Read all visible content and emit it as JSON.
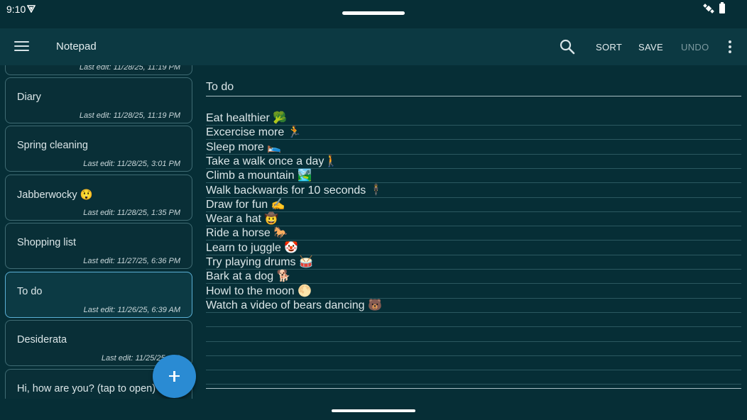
{
  "status": {
    "time": "9:10"
  },
  "appbar": {
    "title": "Notepad",
    "sort_label": "SORT",
    "save_label": "SAVE",
    "undo_label": "UNDO"
  },
  "notes": [
    {
      "title": "",
      "date": "Last edit: 11/28/25, 11:19 PM"
    },
    {
      "title": "Diary",
      "date": "Last edit: 11/28/25, 11:19 PM"
    },
    {
      "title": "Spring cleaning",
      "date": "Last edit: 11/28/25, 3:01 PM"
    },
    {
      "title": "Jabberwocky 😲",
      "date": "Last edit: 11/28/25, 1:35 PM"
    },
    {
      "title": "Shopping list",
      "date": "Last edit: 11/27/25, 6:36 PM"
    },
    {
      "title": "To do",
      "date": "Last edit: 11/26/25, 6:39 AM"
    },
    {
      "title": "Desiderata",
      "date": "Last edit: 11/25/25, 8:2"
    },
    {
      "title": "Hi, how are you? (tap to open)",
      "date": ""
    }
  ],
  "editor": {
    "title": "To do",
    "lines": [
      "Eat healthier 🥦",
      "Excercise more 🏃",
      "Sleep more 🛌",
      "Take a walk once a day🚶",
      "Climb a mountain 🏞️",
      "Walk backwards for 10 seconds 🕴️",
      "Draw for fun ✍️",
      "Wear a hat 🤠",
      "Ride a horse 🐎",
      "Learn to juggle 🤡",
      "Try playing drums 🥁",
      "Bark at a dog 🐕",
      "Howl to the moon 🌕",
      "Watch a video of bears dancing 🐻"
    ]
  },
  "colors": {
    "background": "#062e36",
    "appbar": "#0c3942",
    "fab": "#2a8bd3",
    "selected_border": "#5bb0d6"
  }
}
